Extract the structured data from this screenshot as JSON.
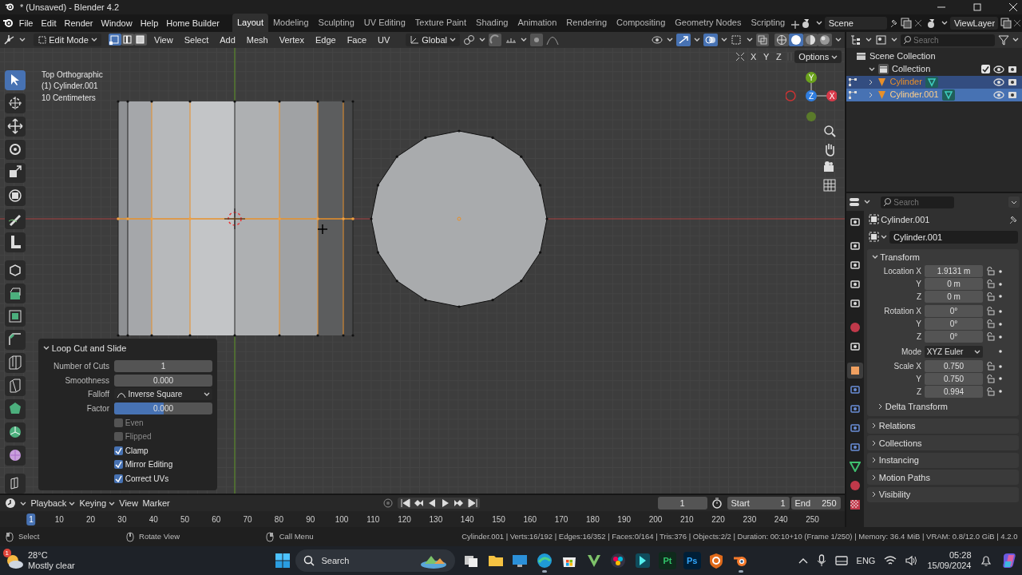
{
  "window": {
    "title": "* (Unsaved) - Blender 4.2"
  },
  "menu": [
    "File",
    "Edit",
    "Render",
    "Window",
    "Help",
    "Home Builder"
  ],
  "workspaces": [
    {
      "label": "Layout",
      "selected": true
    },
    {
      "label": "Modeling",
      "selected": false
    },
    {
      "label": "Sculpting",
      "selected": false
    },
    {
      "label": "UV Editing",
      "selected": false
    },
    {
      "label": "Texture Paint",
      "selected": false
    },
    {
      "label": "Shading",
      "selected": false
    },
    {
      "label": "Animation",
      "selected": false
    },
    {
      "label": "Rendering",
      "selected": false
    },
    {
      "label": "Compositing",
      "selected": false
    },
    {
      "label": "Geometry Nodes",
      "selected": false
    },
    {
      "label": "Scripting",
      "selected": false
    }
  ],
  "scene": "Scene",
  "view_layer": "ViewLayer",
  "header": {
    "mode": "Edit Mode",
    "select_modes": [
      {
        "selected": true
      },
      {
        "selected": false
      },
      {
        "selected": false
      }
    ],
    "menus": [
      "View",
      "Select",
      "Add",
      "Mesh",
      "Vertex",
      "Edge",
      "Face",
      "UV"
    ],
    "orientation": "Global",
    "shading": [
      {
        "selected": false
      },
      {
        "selected": true
      },
      {
        "selected": false
      },
      {
        "selected": false
      }
    ]
  },
  "viewport": {
    "info": [
      "Top Orthographic",
      "(1) Cylinder.001",
      "10 Centimeters"
    ],
    "axis_toggles": [
      "X",
      "Y",
      "Z"
    ],
    "options": "Options",
    "gizmo_labels": [
      "Y",
      "Z",
      "X"
    ]
  },
  "toolbar": [
    {
      "kind": "select",
      "selected": true
    },
    {
      "kind": "cursor",
      "selected": false
    },
    {
      "kind": "move",
      "selected": false
    },
    {
      "kind": "rotate",
      "selected": false
    },
    {
      "kind": "scale",
      "selected": false
    },
    {
      "kind": "transform",
      "selected": false
    },
    {
      "kind": "annotate",
      "selected": false
    },
    {
      "kind": "measure",
      "selected": false
    },
    {
      "kind": "add-cube",
      "selected": false
    },
    {
      "kind": "extrude",
      "selected": false
    },
    {
      "kind": "inset",
      "selected": false
    },
    {
      "kind": "bevel",
      "selected": false
    },
    {
      "kind": "loop-cut",
      "selected": false
    },
    {
      "kind": "knife",
      "selected": false
    },
    {
      "kind": "poly-build",
      "selected": false
    },
    {
      "kind": "spin",
      "selected": false
    },
    {
      "kind": "smooth",
      "selected": false
    },
    {
      "kind": "shear",
      "selected": false
    }
  ],
  "operator_panel": {
    "title": "Loop Cut and Slide",
    "expanded": true,
    "fields": [
      {
        "kind": "number",
        "label": "Number of Cuts",
        "value": "1"
      },
      {
        "kind": "number",
        "label": "Smoothness",
        "value": "0.000"
      },
      {
        "kind": "dropdown",
        "label": "Falloff",
        "value": "Inverse Square"
      },
      {
        "kind": "slider",
        "label": "Factor",
        "value": "0.000",
        "level": 0.5
      },
      {
        "kind": "checkbox",
        "label": "Even",
        "checked": false
      },
      {
        "kind": "checkbox",
        "label": "Flipped",
        "checked": false
      },
      {
        "kind": "checkbox",
        "label": "Clamp",
        "checked": true
      },
      {
        "kind": "checkbox",
        "label": "Mirror Editing",
        "checked": true
      },
      {
        "kind": "checkbox",
        "label": "Correct UVs",
        "checked": true
      }
    ]
  },
  "outliner": {
    "search_placeholder": "Search",
    "tree": [
      {
        "label": "Scene Collection",
        "kind": "scene",
        "children": [
          {
            "label": "Collection",
            "kind": "collection",
            "expanded": true,
            "checked": true,
            "children": [
              {
                "label": "Cylinder",
                "kind": "mesh",
                "selected": true,
                "active": false
              },
              {
                "label": "Cylinder.001",
                "kind": "mesh",
                "selected": true,
                "active": true
              }
            ]
          }
        ]
      }
    ]
  },
  "properties": {
    "search_placeholder": "Search",
    "object_name": "Cylinder.001",
    "name_field": "Cylinder.001",
    "tabs": [
      {
        "kind": "tool",
        "selected": false
      },
      {
        "kind": "render",
        "selected": false
      },
      {
        "kind": "output",
        "selected": false
      },
      {
        "kind": "view-layer",
        "selected": false
      },
      {
        "kind": "scene",
        "selected": false
      },
      {
        "kind": "world",
        "selected": false
      },
      {
        "kind": "collection",
        "selected": false
      },
      {
        "kind": "object",
        "selected": true
      },
      {
        "kind": "modifier",
        "selected": false
      },
      {
        "kind": "particles",
        "selected": false
      },
      {
        "kind": "physics",
        "selected": false
      },
      {
        "kind": "constraints",
        "selected": false
      },
      {
        "kind": "data",
        "selected": false
      },
      {
        "kind": "material",
        "selected": false
      },
      {
        "kind": "texture",
        "selected": false
      }
    ],
    "transform": {
      "title": "Transform",
      "expanded": true,
      "groups": [
        {
          "kind": "fields",
          "rows": [
            {
              "label": "Location X",
              "value": "1.9131 m"
            },
            {
              "label": "Y",
              "value": "0 m"
            },
            {
              "label": "Z",
              "value": "0 m"
            }
          ]
        },
        {
          "kind": "fields",
          "rows": [
            {
              "label": "Rotation X",
              "value": "0°"
            },
            {
              "label": "Y",
              "value": "0°"
            },
            {
              "label": "Z",
              "value": "0°"
            }
          ]
        },
        {
          "kind": "dropdown",
          "label": "Mode",
          "value": "XYZ Euler"
        },
        {
          "kind": "fields",
          "rows": [
            {
              "label": "Scale X",
              "value": "0.750"
            },
            {
              "label": "Y",
              "value": "0.750"
            },
            {
              "label": "Z",
              "value": "0.994"
            }
          ]
        }
      ],
      "subpanel": "Delta Transform"
    },
    "panels": [
      "Relations",
      "Collections",
      "Instancing",
      "Motion Paths",
      "Visibility"
    ]
  },
  "timeline": {
    "menus": [
      "Playback",
      "Keying",
      "View",
      "Marker"
    ],
    "current_frame": "1",
    "start_label": "Start",
    "start": "1",
    "end_label": "End",
    "end": "250",
    "ticks": [
      {
        "label": "1",
        "selected": true
      },
      {
        "label": "10",
        "selected": false
      },
      {
        "label": "20",
        "selected": false
      },
      {
        "label": "30",
        "selected": false
      },
      {
        "label": "40",
        "selected": false
      },
      {
        "label": "50",
        "selected": false
      },
      {
        "label": "60",
        "selected": false
      },
      {
        "label": "70",
        "selected": false
      },
      {
        "label": "80",
        "selected": false
      },
      {
        "label": "90",
        "selected": false
      },
      {
        "label": "100",
        "selected": false
      },
      {
        "label": "110",
        "selected": false
      },
      {
        "label": "120",
        "selected": false
      },
      {
        "label": "130",
        "selected": false
      },
      {
        "label": "140",
        "selected": false
      },
      {
        "label": "150",
        "selected": false
      },
      {
        "label": "160",
        "selected": false
      },
      {
        "label": "170",
        "selected": false
      },
      {
        "label": "180",
        "selected": false
      },
      {
        "label": "190",
        "selected": false
      },
      {
        "label": "200",
        "selected": false
      },
      {
        "label": "210",
        "selected": false
      },
      {
        "label": "220",
        "selected": false
      },
      {
        "label": "230",
        "selected": false
      },
      {
        "label": "240",
        "selected": false
      },
      {
        "label": "250",
        "selected": false
      }
    ]
  },
  "status_bar": {
    "hints": [
      "Select",
      "Rotate View",
      "Call Menu"
    ],
    "stats": "Cylinder.001 | Verts:16/192 | Edges:16/352 | Faces:0/164 | Tris:376 | Objects:2/2 | Duration: 00:10+10 (Frame 1/250) | Memory: 36.4 MiB | VRAM: 0.8/12.0 GiB | 4.2.0"
  },
  "taskbar": {
    "weather_badge": "1",
    "temperature": "28°C",
    "weather": "Mostly clear",
    "search": "Search",
    "apps": [
      {
        "kind": "task-view",
        "running": false
      },
      {
        "kind": "folder",
        "running": false
      },
      {
        "kind": "monitor",
        "running": false
      },
      {
        "kind": "browser",
        "running": true
      },
      {
        "kind": "store",
        "running": false
      },
      {
        "kind": "vector",
        "running": false
      },
      {
        "kind": "resolve",
        "running": false
      },
      {
        "kind": "arrow",
        "running": false
      },
      {
        "kind": "pt",
        "label": "Pt",
        "running": false
      },
      {
        "kind": "ps",
        "label": "Ps",
        "running": false
      },
      {
        "kind": "shield",
        "running": false
      },
      {
        "kind": "blender",
        "running": true
      }
    ],
    "language": "ENG",
    "time": "05:28",
    "date": "15/09/2024"
  }
}
